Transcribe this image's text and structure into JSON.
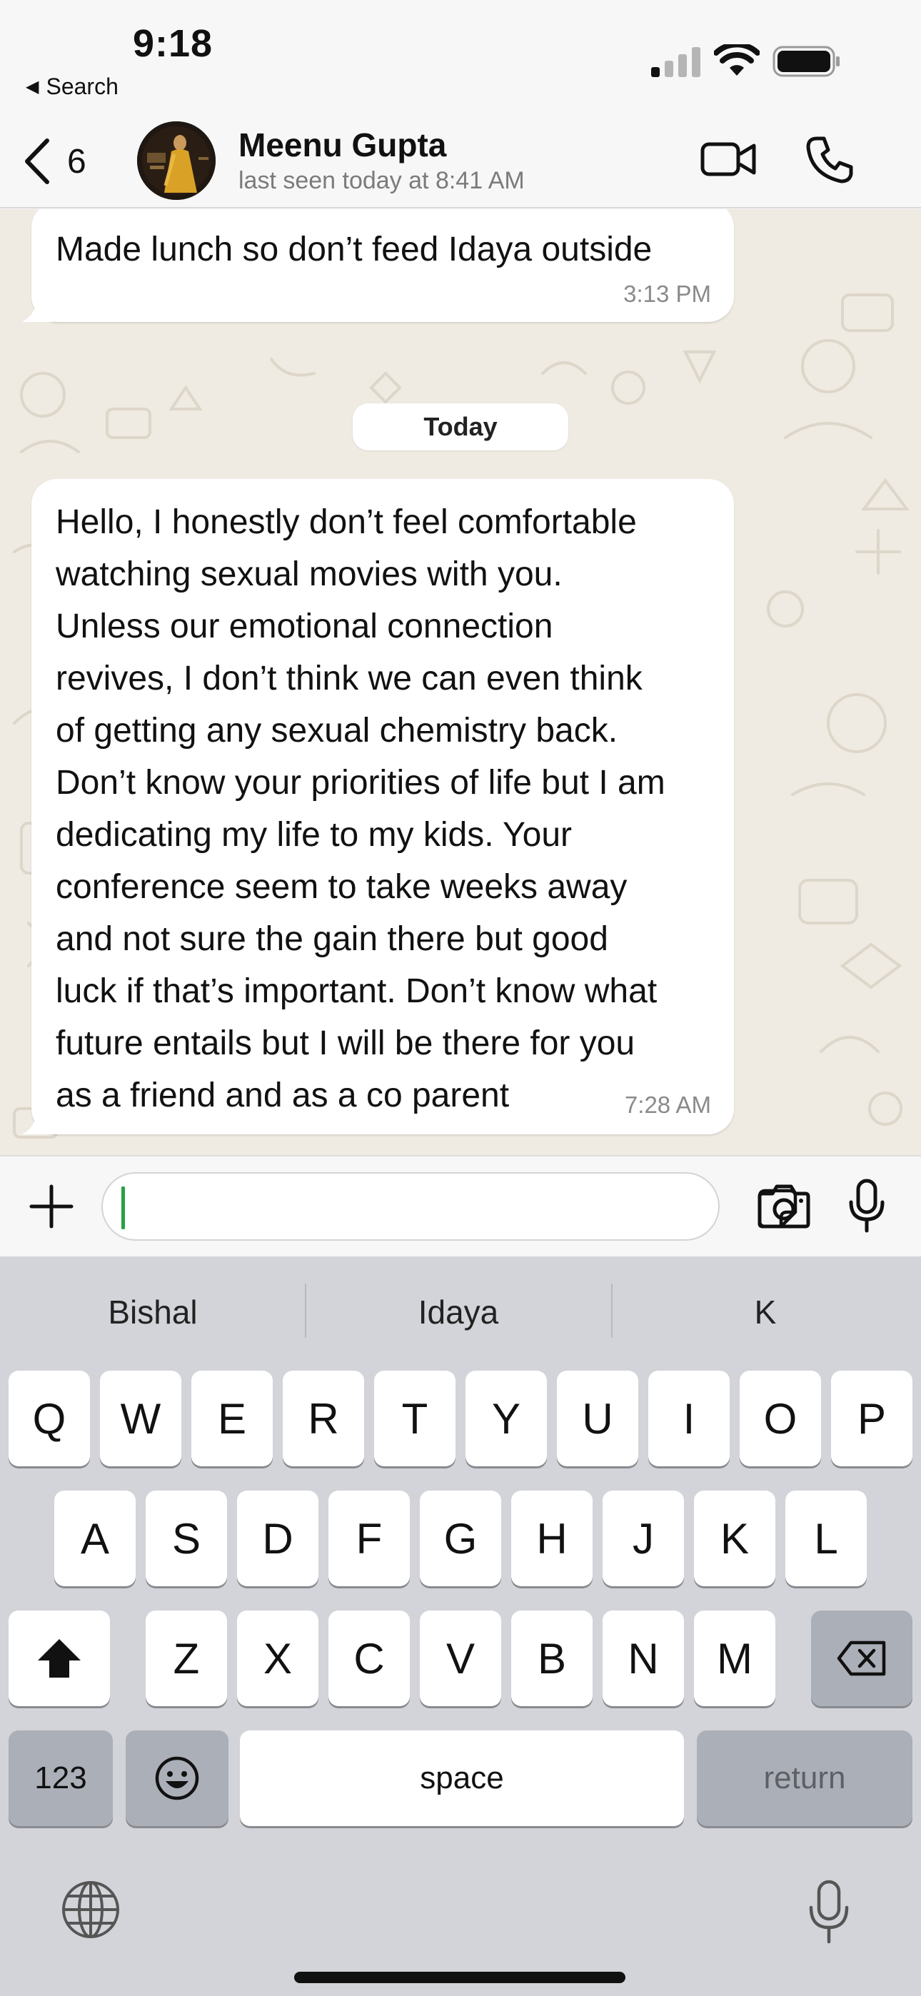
{
  "status_bar": {
    "time": "9:18",
    "back_label": "Search"
  },
  "chat_header": {
    "unread_count": "6",
    "contact_name": "Meenu Gupta",
    "last_seen": "last seen today at 8:41 AM"
  },
  "messages": [
    {
      "text": "Made lunch so don’t feed Idaya outside",
      "time": "3:13 PM"
    },
    {
      "text": "Hello, I honestly don’t feel comfortable\nwatching sexual movies with you.\nUnless our emotional connection\nrevives, I don’t think we can even think\nof getting any sexual chemistry back.\nDon’t know your priorities of life but I am\ndedicating my life to my kids. Your\nconference seem to take weeks away\nand not sure the gain there but good\nluck if that’s important. Don’t know what\nfuture entails but I will be there for you\nas a friend and as a co parent",
      "time": "7:28 AM"
    }
  ],
  "date_separator": "Today",
  "input": {
    "value": ""
  },
  "keyboard": {
    "suggestions": [
      "Bishal",
      "Idaya",
      "K"
    ],
    "row1": [
      "Q",
      "W",
      "E",
      "R",
      "T",
      "Y",
      "U",
      "I",
      "O",
      "P"
    ],
    "row2": [
      "A",
      "S",
      "D",
      "F",
      "G",
      "H",
      "J",
      "K",
      "L"
    ],
    "row3": [
      "Z",
      "X",
      "C",
      "V",
      "B",
      "N",
      "M"
    ],
    "numbers_label": "123",
    "space_label": "space",
    "return_label": "return"
  },
  "icons": {
    "status": [
      "cellular-signal-icon",
      "wifi-icon",
      "battery-icon"
    ],
    "header": [
      "chevron-left-icon",
      "video-call-icon",
      "phone-call-icon"
    ],
    "input_bar": [
      "plus-icon",
      "sticker-icon",
      "camera-icon",
      "microphone-icon"
    ],
    "keyboard": [
      "shift-icon",
      "backspace-icon",
      "emoji-icon",
      "globe-icon",
      "dictation-icon"
    ]
  },
  "colors": {
    "chat_background": "#efeae2",
    "bubble": "#ffffff",
    "caret": "#25a244",
    "keyboard_background": "#d2d4d9"
  }
}
